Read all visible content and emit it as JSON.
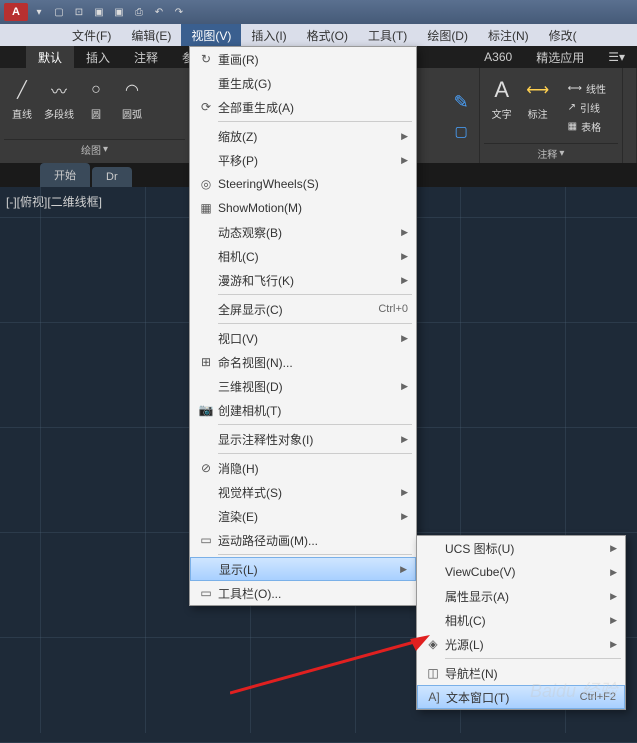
{
  "titlebar": {
    "logo": "A"
  },
  "menubar": {
    "items": [
      "文件(F)",
      "编辑(E)",
      "视图(V)",
      "插入(I)",
      "格式(O)",
      "工具(T)",
      "绘图(D)",
      "标注(N)",
      "修改("
    ],
    "activeIndex": 2
  },
  "tabs": {
    "items": [
      "默认",
      "插入",
      "注释",
      "参数"
    ],
    "rightItems": [
      "A360",
      "精选应用"
    ],
    "activeIndex": 0
  },
  "ribbon": {
    "draw": {
      "label": "绘图",
      "tools": [
        "直线",
        "多段线",
        "圆",
        "圆弧"
      ]
    },
    "annotate": {
      "label": "注释",
      "tools": [
        "文字",
        "标注"
      ],
      "small": [
        "线性",
        "引线",
        "表格"
      ]
    }
  },
  "filetabs": {
    "items": [
      "开始",
      "Dr"
    ]
  },
  "viewport": {
    "label": "[-][俯视][二维线框]"
  },
  "viewMenu": {
    "items": [
      {
        "icon": "↻",
        "label": "重画(R)"
      },
      {
        "icon": "",
        "label": "重生成(G)"
      },
      {
        "icon": "⟳",
        "label": "全部重生成(A)"
      },
      {
        "sep": true
      },
      {
        "icon": "",
        "label": "缩放(Z)",
        "arrow": true
      },
      {
        "icon": "",
        "label": "平移(P)",
        "arrow": true
      },
      {
        "icon": "◎",
        "label": "SteeringWheels(S)"
      },
      {
        "icon": "▦",
        "label": "ShowMotion(M)"
      },
      {
        "icon": "",
        "label": "动态观察(B)",
        "arrow": true
      },
      {
        "icon": "",
        "label": "相机(C)",
        "arrow": true
      },
      {
        "icon": "",
        "label": "漫游和飞行(K)",
        "arrow": true
      },
      {
        "sep": true
      },
      {
        "icon": "",
        "label": "全屏显示(C)",
        "shortcut": "Ctrl+0"
      },
      {
        "sep": true
      },
      {
        "icon": "",
        "label": "视口(V)",
        "arrow": true
      },
      {
        "icon": "⊞",
        "label": "命名视图(N)..."
      },
      {
        "icon": "",
        "label": "三维视图(D)",
        "arrow": true
      },
      {
        "icon": "📷",
        "label": "创建相机(T)"
      },
      {
        "sep": true
      },
      {
        "icon": "",
        "label": "显示注释性对象(I)",
        "arrow": true
      },
      {
        "sep": true
      },
      {
        "icon": "⊘",
        "label": "消隐(H)"
      },
      {
        "icon": "",
        "label": "视觉样式(S)",
        "arrow": true
      },
      {
        "icon": "",
        "label": "渲染(E)",
        "arrow": true
      },
      {
        "icon": "▭",
        "label": "运动路径动画(M)..."
      },
      {
        "sep": true
      },
      {
        "icon": "",
        "label": "显示(L)",
        "arrow": true,
        "highlight": true
      },
      {
        "icon": "▭",
        "label": "工具栏(O)..."
      }
    ]
  },
  "displaySubmenu": {
    "items": [
      {
        "icon": "",
        "label": "UCS 图标(U)",
        "arrow": true
      },
      {
        "icon": "",
        "label": "ViewCube(V)",
        "arrow": true
      },
      {
        "icon": "",
        "label": "属性显示(A)",
        "arrow": true
      },
      {
        "icon": "",
        "label": "相机(C)",
        "arrow": true
      },
      {
        "icon": "◈",
        "label": "光源(L)",
        "arrow": true
      },
      {
        "sep": true
      },
      {
        "icon": "◫",
        "label": "导航栏(N)"
      },
      {
        "icon": "A]",
        "label": "文本窗口(T)",
        "highlight": true,
        "extra": "Ctrl+F2"
      }
    ]
  },
  "watermark": "Baidu 经验"
}
